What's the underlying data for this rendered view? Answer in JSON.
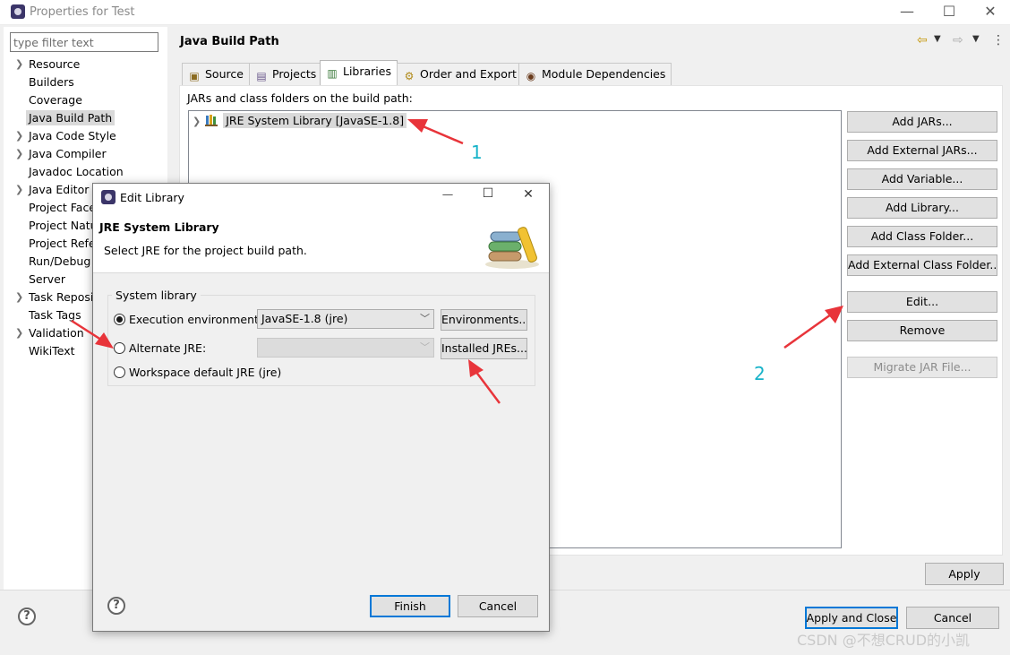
{
  "window": {
    "title": "Properties for Test",
    "controls": {
      "minimize": "—",
      "maximize": "☐",
      "close": "✕"
    }
  },
  "filter": {
    "value": "type filter text"
  },
  "nav": {
    "items": [
      {
        "label": "Resource",
        "expandable": true
      },
      {
        "label": "Builders",
        "expandable": false
      },
      {
        "label": "Coverage",
        "expandable": false
      },
      {
        "label": "Java Build Path",
        "expandable": false,
        "selected": true
      },
      {
        "label": "Java Code Style",
        "expandable": true
      },
      {
        "label": "Java Compiler",
        "expandable": true
      },
      {
        "label": "Javadoc Location",
        "expandable": false
      },
      {
        "label": "Java Editor",
        "expandable": true
      },
      {
        "label": "Project Facets",
        "expandable": false
      },
      {
        "label": "Project Natures",
        "expandable": false
      },
      {
        "label": "Project References",
        "expandable": false
      },
      {
        "label": "Run/Debug Settings",
        "expandable": false
      },
      {
        "label": "Server",
        "expandable": false
      },
      {
        "label": "Task Repository",
        "expandable": true
      },
      {
        "label": "Task Tags",
        "expandable": false
      },
      {
        "label": "Validation",
        "expandable": true
      },
      {
        "label": "WikiText",
        "expandable": false
      }
    ]
  },
  "page": {
    "title": "Java Build Path",
    "tabs": [
      {
        "label": "Source",
        "icon": "source-folder-icon"
      },
      {
        "label": "Projects",
        "icon": "projects-icon"
      },
      {
        "label": "Libraries",
        "icon": "libraries-icon",
        "active": true
      },
      {
        "label": "Order and Export",
        "icon": "order-export-icon"
      },
      {
        "label": "Module Dependencies",
        "icon": "module-icon"
      }
    ],
    "jars_label": "JARs and class folders on the build path:",
    "tree_item": "JRE System Library [JavaSE-1.8]",
    "buttons": {
      "add_jars": "Add JARs...",
      "add_external_jars": "Add External JARs...",
      "add_variable": "Add Variable...",
      "add_library": "Add Library...",
      "add_class_folder": "Add Class Folder...",
      "add_external_class_folder": "Add External Class Folder...",
      "edit": "Edit...",
      "remove": "Remove",
      "migrate_jar": "Migrate JAR File..."
    },
    "apply": "Apply"
  },
  "bottom": {
    "apply_and_close": "Apply and Close",
    "cancel": "Cancel",
    "help": "?"
  },
  "dialog": {
    "title": "Edit Library",
    "header_title": "JRE System Library",
    "header_desc": "Select JRE for the project build path.",
    "group_label": "System library",
    "execution_env_label": "Execution environment:",
    "execution_env_value": "JavaSE-1.8 (jre)",
    "environments_button": "Environments...",
    "alternate_jre_label": "Alternate JRE:",
    "installed_jres_button": "Installed JREs...",
    "workspace_default_label": "Workspace default JRE (jre)",
    "finish": "Finish",
    "cancel": "Cancel",
    "help": "?"
  },
  "annotations": {
    "num1": "1",
    "num2": "2"
  },
  "watermark": "CSDN @不想CRUD的小凯",
  "colors": {
    "arrow": "#e8343a",
    "annotation_number": "#18b3c9",
    "primary_border": "#0078d7"
  }
}
